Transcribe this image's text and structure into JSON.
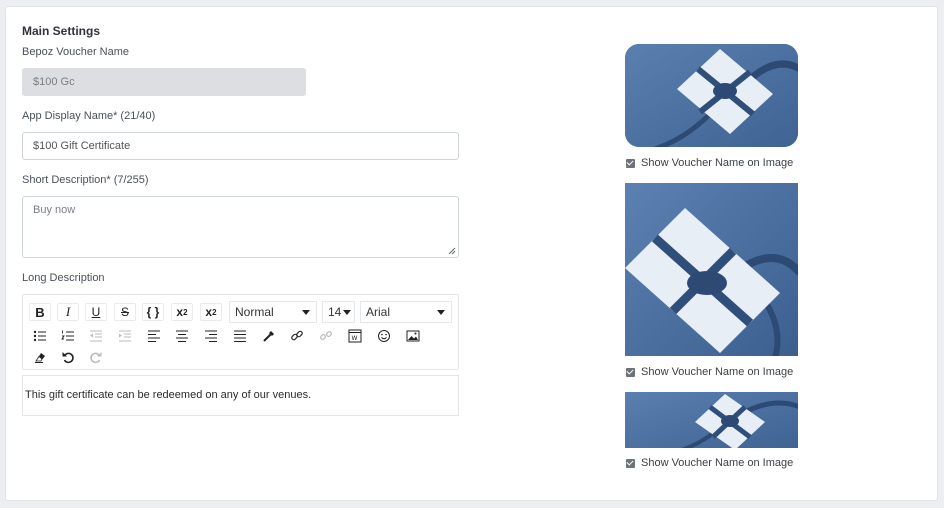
{
  "main_settings": {
    "title": "Main Settings",
    "voucher_name_label": "Bepoz Voucher Name",
    "voucher_name_value": "$100 Gc",
    "display_name_label": "App Display Name* (21/40)",
    "display_name_value": "$100 Gift Certificate",
    "short_desc_label": "Short Description* (7/255)",
    "short_desc_value": "Buy now",
    "long_desc_label": "Long Description",
    "long_desc_value": "This gift certificate can be redeemed on any of our venues."
  },
  "toolbar": {
    "format_value": "Normal",
    "size_value": "14",
    "font_value": "Arial",
    "icons": [
      "bold-icon",
      "italic-icon",
      "underline-icon",
      "strikethrough-icon",
      "code-icon",
      "superscript-icon",
      "subscript-icon",
      "unordered-list-icon",
      "ordered-list-icon",
      "outdent-icon",
      "indent-icon",
      "align-left-icon",
      "align-center-icon",
      "align-right-icon",
      "align-justify-icon",
      "color-picker-icon",
      "link-icon",
      "unlink-icon",
      "embed-icon",
      "emoji-icon",
      "image-icon",
      "eraser-icon",
      "undo-icon",
      "redo-icon"
    ]
  },
  "images": [
    {
      "checkbox_label": "Show Voucher Name on Image",
      "checked": true
    },
    {
      "checkbox_label": "Show Voucher Name on Image",
      "checked": true
    },
    {
      "checkbox_label": "Show Voucher Name on Image",
      "checked": true
    }
  ],
  "colors": {
    "image_blue": "#4a6f9e",
    "disabled_input": "#dcdee1",
    "background": "#eceef1"
  }
}
